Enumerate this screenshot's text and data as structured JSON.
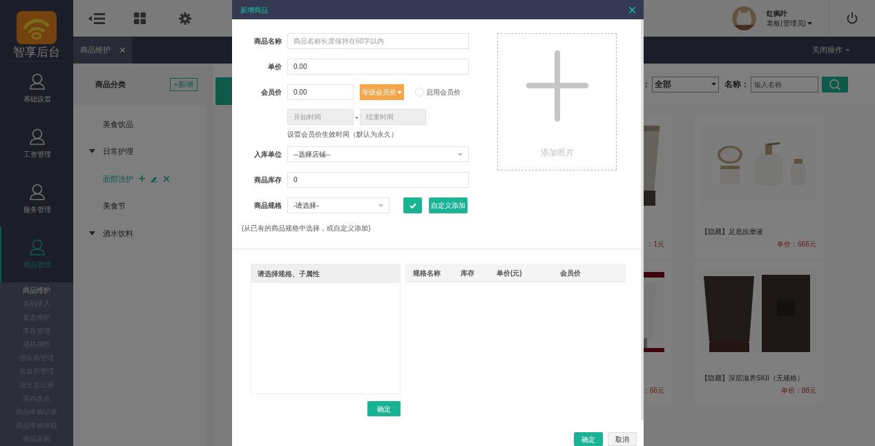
{
  "sidebar": {
    "logo_text": "智享后台",
    "items": [
      {
        "label": "基础设置",
        "selected": false
      },
      {
        "label": "工资管理",
        "selected": false
      },
      {
        "label": "服务管理",
        "selected": false
      },
      {
        "label": "商品管理",
        "selected": true
      }
    ],
    "submenu": [
      {
        "label": "商品维护",
        "selected": true
      },
      {
        "label": "条码录入",
        "selected": false
      },
      {
        "label": "套盒维护",
        "selected": false
      },
      {
        "label": "库存管理",
        "selected": false
      },
      {
        "label": "规格属性",
        "selected": false
      },
      {
        "label": "供应商管理",
        "selected": false
      },
      {
        "label": "批发商管理",
        "selected": false
      },
      {
        "label": "进出货记录",
        "selected": false
      },
      {
        "label": "库存盘点",
        "selected": false
      },
      {
        "label": "商品申购记录",
        "selected": false
      },
      {
        "label": "商品申购审核",
        "selected": false
      },
      {
        "label": "商品采购",
        "selected": false
      }
    ]
  },
  "user": {
    "name": "红枫叶",
    "role": "老板(管理员)"
  },
  "tabs": [
    {
      "label": "商品维护",
      "selected": true
    }
  ],
  "close_menu": "关闭操作",
  "category_panel": {
    "title": "商品分类",
    "add_button": "+新增",
    "tree": [
      {
        "label": "美食饮品",
        "kind": "item",
        "selected": false
      },
      {
        "label": "日常护理",
        "kind": "group",
        "selected": false,
        "children": [
          {
            "label": "面部洗护",
            "kind": "item",
            "selected": true
          }
        ]
      },
      {
        "label": "美食节",
        "kind": "item",
        "selected": false
      },
      {
        "label": "酒水饮料",
        "kind": "group",
        "selected": false
      }
    ]
  },
  "filter": {
    "label": "：",
    "select_value": "全部",
    "name_label": "名称：",
    "name_placeholder": "输入名称"
  },
  "products": [
    {
      "price": "：1元"
    },
    {
      "title": "【隐藏】足底按摩液",
      "price": "单价：666元"
    },
    {
      "price": "：66元"
    },
    {
      "title": "【隐藏】深层滋养SKII（无规格）",
      "price": "单价：88元"
    }
  ],
  "dialog": {
    "title": "新增商品",
    "fields": [
      {
        "kind": "text",
        "label": "商品名称",
        "placeholder": "商品名称长度保持在60字以内"
      },
      {
        "kind": "text",
        "label": "单价",
        "value": "0.00"
      },
      {
        "kind": "member_price",
        "label": "会员价",
        "value": "0.00",
        "level_button": "等级会员价",
        "toggle_label": "启用会员价",
        "checked": false,
        "start_placeholder": "开始时间",
        "range_separator": "-",
        "end_placeholder": "结束时间",
        "hint": "设置会员价生效时间（默认为永久）"
      },
      {
        "kind": "select",
        "label": "入库单位",
        "value": "--选择店铺--"
      },
      {
        "kind": "text",
        "label": "商品库存",
        "value": "0"
      },
      {
        "kind": "spec",
        "label": "商品规格",
        "value": "-请选择-",
        "custom_button": "自定义添加",
        "hint": "(从已有的商品规格中选择，或自定义添加)"
      }
    ],
    "photo_label": "添加照片",
    "spec_panel": {
      "title": "请选择规格、子属性",
      "confirm": "确定"
    },
    "spec_table": {
      "columns": [
        "规格名称",
        "库存",
        "单价(元)",
        "会员价"
      ]
    },
    "buttons": [
      {
        "label": "确定",
        "kind": "primary"
      },
      {
        "label": "取消",
        "kind": "default"
      }
    ]
  }
}
